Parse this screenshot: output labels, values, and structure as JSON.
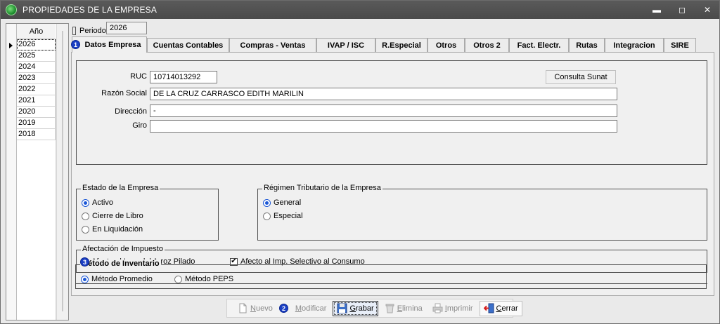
{
  "window": {
    "title": "PROPIEDADES DE LA EMPRESA",
    "min_glyph": "▬",
    "max_glyph": "◻",
    "close_glyph": "✕"
  },
  "years": {
    "header": "Año",
    "rows": [
      "2026",
      "2025",
      "2024",
      "2023",
      "2022",
      "2021",
      "2020",
      "2019",
      "2018"
    ]
  },
  "periodo": {
    "label": "Periodo",
    "value": "2026"
  },
  "tabs": [
    "Datos Empresa",
    "Cuentas Contables",
    "Compras - Ventas",
    "IVAP / ISC",
    "R.Especial",
    "Otros",
    "Otros 2",
    "Fact. Electr.",
    "Rutas",
    "Integracion",
    "SIRE"
  ],
  "badges": {
    "b1": "1",
    "b2": "2",
    "b3": "3"
  },
  "empresa": {
    "ruc_label": "RUC",
    "ruc_value": "10714013292",
    "razon_label": "Razón Social",
    "razon_value": "DE LA CRUZ CARRASCO EDITH MARILIN",
    "direccion_label": "Dirección",
    "direccion_value": "-",
    "giro_label": "Giro",
    "giro_value": "",
    "consulta_button": "Consulta Sunat"
  },
  "estado": {
    "title": "Estado de la Empresa",
    "options": [
      "Activo",
      "Cierre de Libro",
      "En Liquidación"
    ],
    "selected": "Activo"
  },
  "regimen": {
    "title": "Régimen Tributario de la Empresa",
    "options": [
      "General",
      "Especial"
    ],
    "selected": "General"
  },
  "afectacion": {
    "title": "Afectación de  Impuesto",
    "arroz": "Afecto al Imp. del Arroz Pilado",
    "selectivo": "Afecto al Imp. Selectivo al Consumo",
    "selectivo_checked": true
  },
  "inventario": {
    "title": "Método de Inventario",
    "options": [
      "Método Promedio",
      "Método PEPS"
    ],
    "selected": "Método Promedio"
  },
  "toolbar": {
    "nuevo_ul": "N",
    "nuevo_rest": "uevo",
    "modificar_ul": "M",
    "modificar_rest": "odificar",
    "grabar_ul": "G",
    "grabar_rest": "rabar",
    "elimina_ul": "E",
    "elimina_rest": "limina",
    "imprimir_ul": "I",
    "imprimir_rest": "mprimir",
    "cerrar_ul": "C",
    "cerrar_rest": "errar"
  },
  "colors": {
    "accent": "#1a56d6",
    "badge": "#1a3fc4",
    "titlebar": "#4f4f4f"
  }
}
